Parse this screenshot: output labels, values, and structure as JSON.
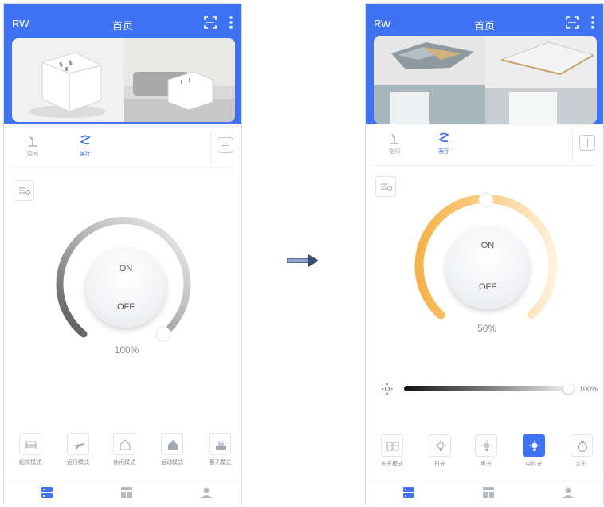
{
  "left_phone": {
    "header": {
      "brand": "RW",
      "title": "首页"
    },
    "tabs": [
      {
        "label": "空间",
        "active": false
      },
      {
        "label": "客厅",
        "active": true
      }
    ],
    "dial": {
      "on_label": "ON",
      "off_label": "OFF",
      "percent": "100%",
      "level": 1.0
    },
    "modes": [
      {
        "label": "起床模式",
        "icon": "bed-icon"
      },
      {
        "label": "远行模式",
        "icon": "plane-icon"
      },
      {
        "label": "休闲模式",
        "icon": "house-outline-icon"
      },
      {
        "label": "运动模式",
        "icon": "house-filled-icon"
      },
      {
        "label": "春天模式",
        "icon": "cake-icon"
      }
    ]
  },
  "right_phone": {
    "header": {
      "brand": "RW",
      "title": "首页"
    },
    "tabs": [
      {
        "label": "空间",
        "active": false
      },
      {
        "label": "客厅",
        "active": true
      }
    ],
    "dial": {
      "on_label": "ON",
      "off_label": "OFF",
      "percent": "50%",
      "level": 0.5
    },
    "brightness": {
      "value": "100%",
      "level": 1.0
    },
    "modes": [
      {
        "label": "冬天模式",
        "icon": "book-icon",
        "active": false
      },
      {
        "label": "日光",
        "icon": "bulb-icon",
        "active": false
      },
      {
        "label": "黑光",
        "icon": "bulb-icon",
        "active": false
      },
      {
        "label": "中性光",
        "icon": "bulb-icon",
        "active": true
      },
      {
        "label": "定时",
        "icon": "timer-icon",
        "active": false
      }
    ]
  },
  "colors": {
    "header": "#3f73f3",
    "accent": "#3f73f3",
    "warm_arc": "#f7b24a",
    "cool_arc": "#fbe4bb"
  }
}
